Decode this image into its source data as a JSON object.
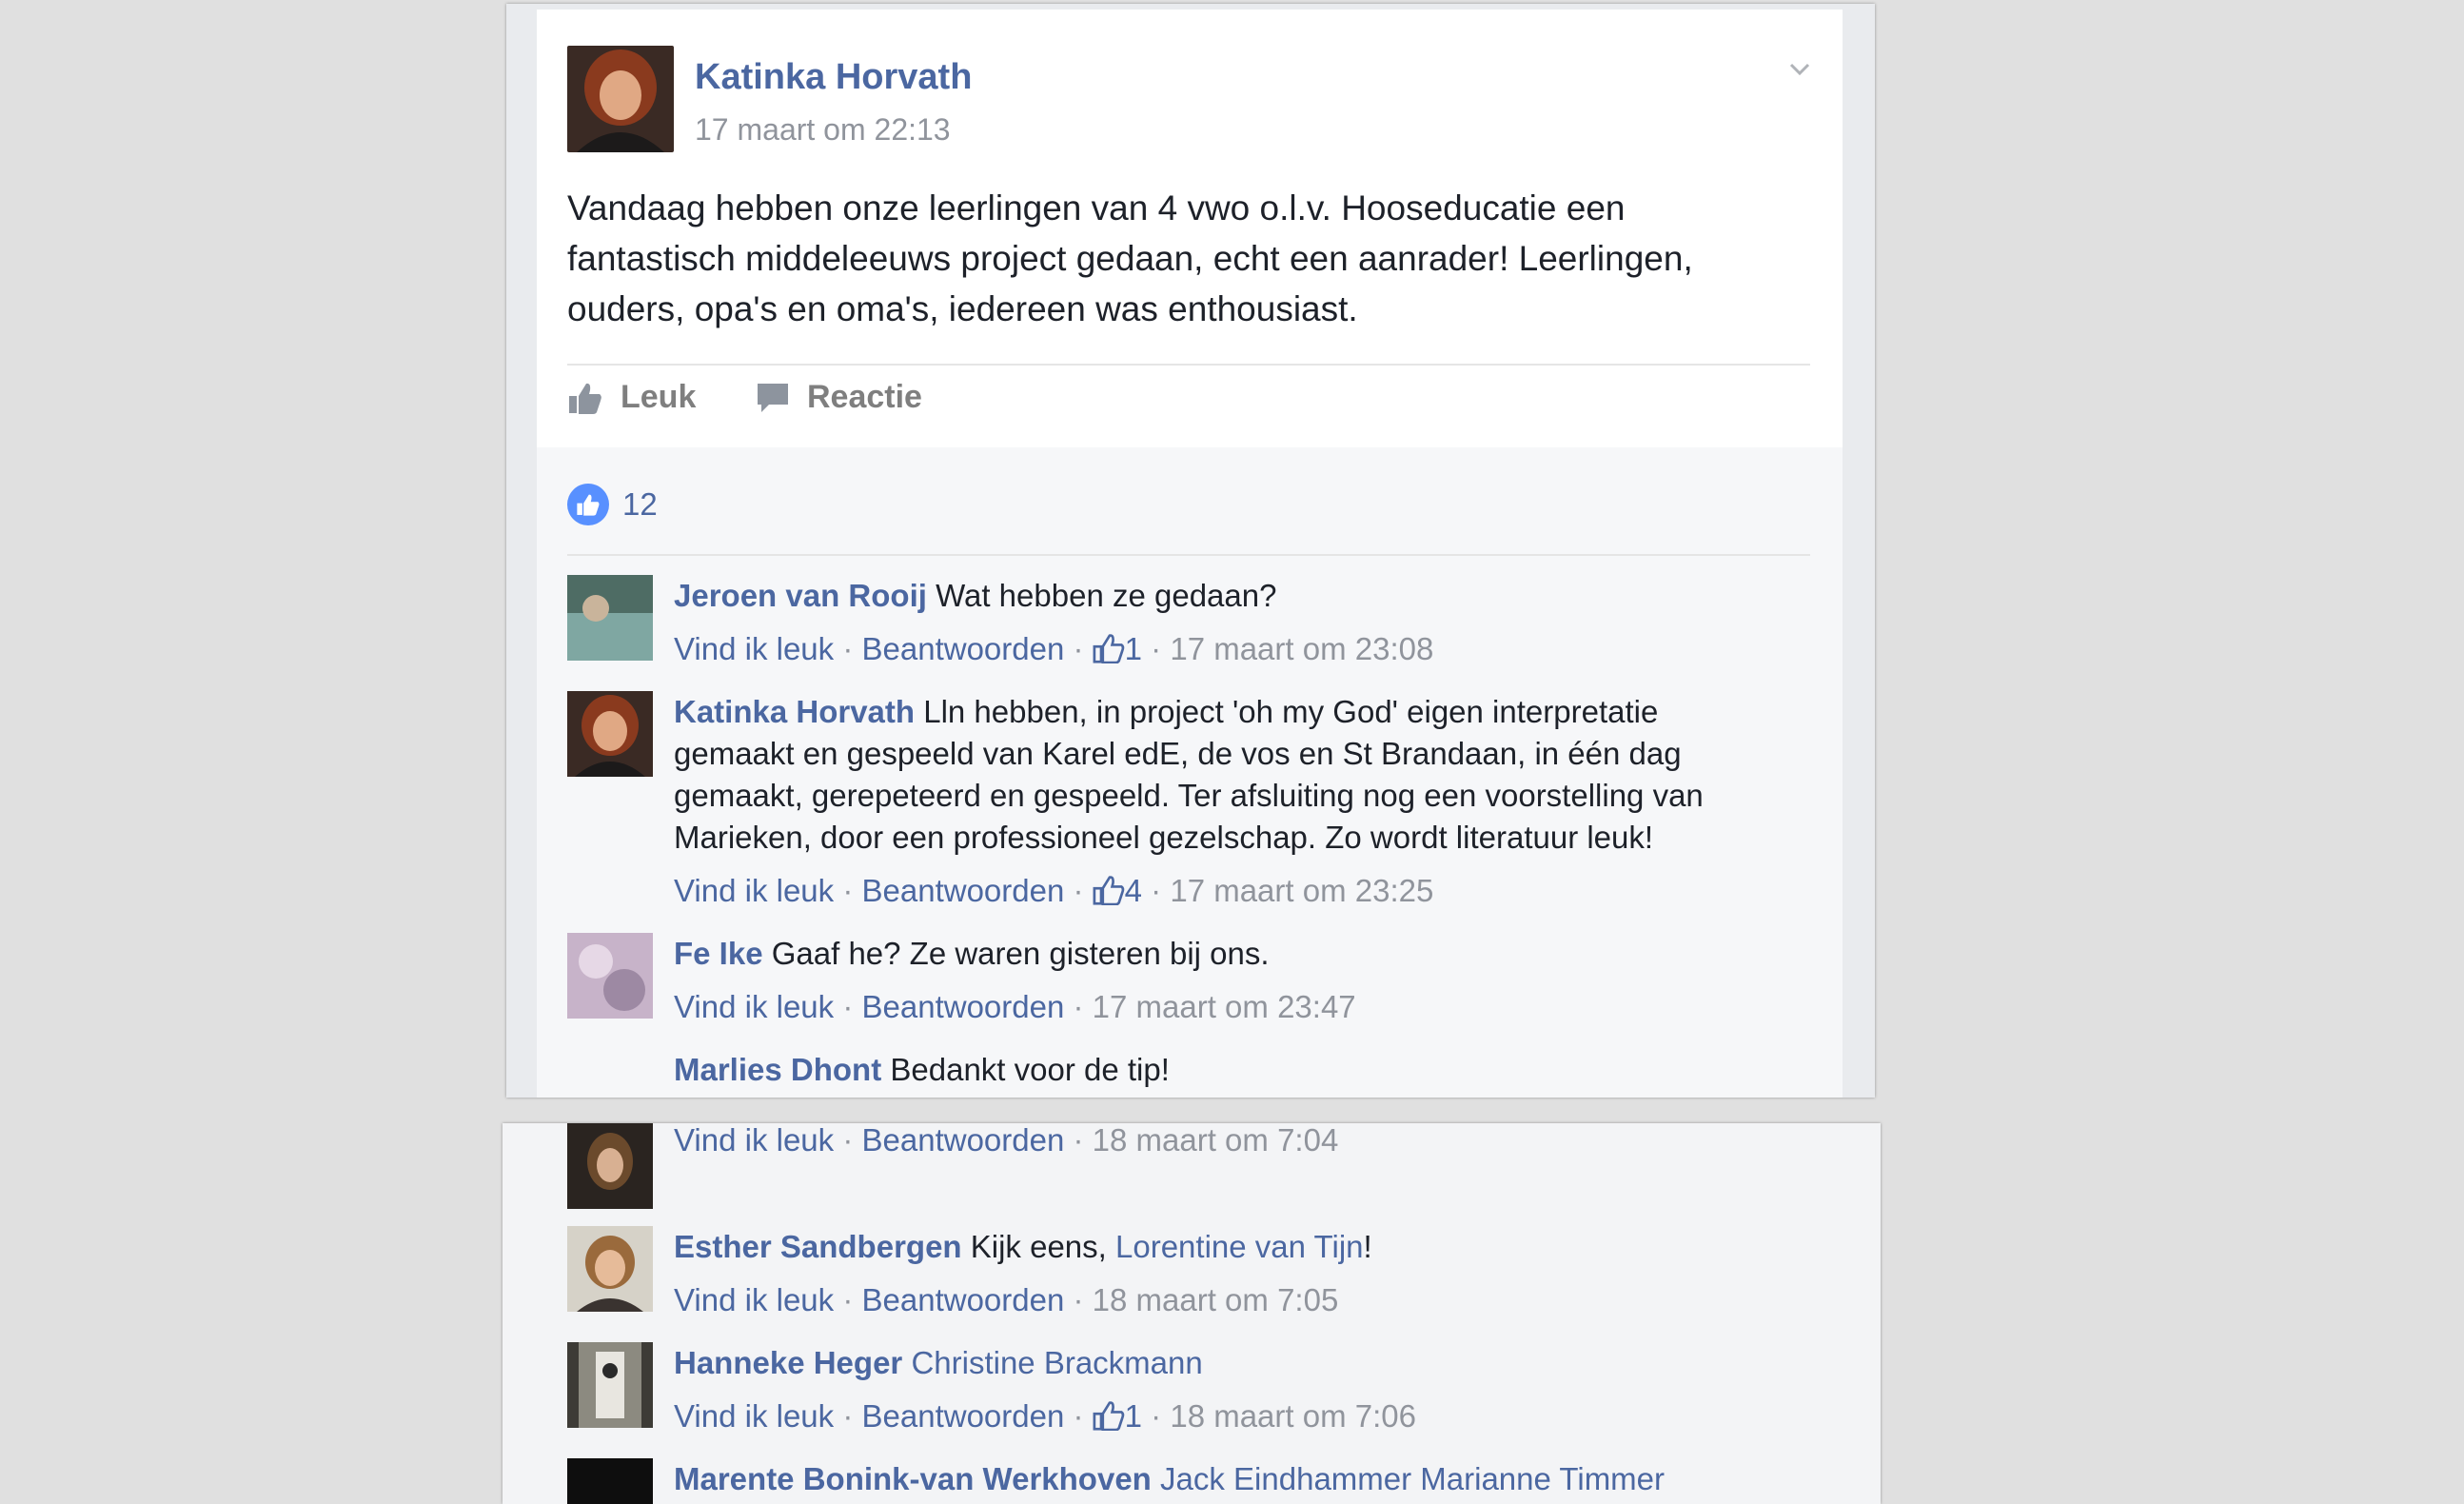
{
  "post": {
    "author": "Katinka Horvath",
    "timestamp": "17 maart om 22:13",
    "text": "Vandaag hebben onze leerlingen van 4 vwo o.l.v. Hooseducatie een fantastisch middeleeuws project gedaan, echt een aanrader! Leerlingen, ouders, opa's en oma's, iedereen was enthousiast.",
    "like_label": "Leuk",
    "comment_label": "Reactie",
    "like_count": "12"
  },
  "comments": [
    {
      "name": "Jeroen van Rooij",
      "text": " Wat hebben ze gedaan?",
      "like": "Vind ik leuk",
      "reply": "Beantwoorden",
      "likes": "1",
      "time": "17 maart om 23:08"
    },
    {
      "name": "Katinka Horvath",
      "text": " Lln hebben, in project 'oh my God' eigen interpretatie gemaakt en gespeeld van Karel edE, de vos en St Brandaan, in één dag gemaakt, gerepeteerd en gespeeld. Ter afsluiting nog een voorstelling van Marieken, door een professioneel gezelschap. Zo wordt literatuur leuk!",
      "like": "Vind ik leuk",
      "reply": "Beantwoorden",
      "likes": "4",
      "time": "17 maart om 23:25"
    },
    {
      "name": "Fe Ike",
      "text": " Gaaf he? Ze waren gisteren bij ons.",
      "like": "Vind ik leuk",
      "reply": "Beantwoorden",
      "time": "17 maart om 23:47"
    },
    {
      "name": "Marlies Dhont",
      "text": " Bedankt voor de tip!"
    }
  ],
  "comments2": [
    {
      "like": "Vind ik leuk",
      "reply": "Beantwoorden",
      "time": "18 maart om 7:04"
    },
    {
      "name": "Esther Sandbergen",
      "text": " Kijk eens, ",
      "mention": "Lorentine van Tijn",
      "suffix": "!",
      "like": "Vind ik leuk",
      "reply": "Beantwoorden",
      "time": "18 maart om 7:05"
    },
    {
      "name": "Hanneke Heger",
      "mention": "Christine Brackmann",
      "like": "Vind ik leuk",
      "reply": "Beantwoorden",
      "likes": "1",
      "time": "18 maart om 7:06"
    },
    {
      "name": "Marente Bonink-van Werkhoven",
      "mention": "Jack Eindhammer Marianne Timmer"
    }
  ],
  "sep": " · ",
  "colors": {
    "link": "#4b67a1",
    "meta": "#90949c",
    "like_blue": "#5890ff"
  }
}
